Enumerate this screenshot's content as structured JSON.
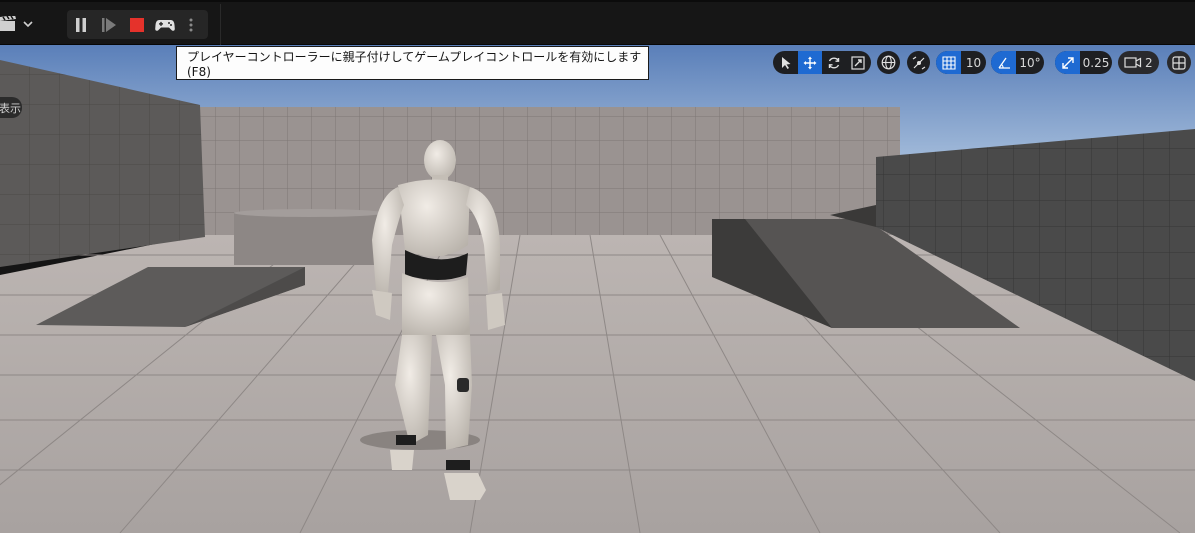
{
  "toolbar": {
    "mode_icon": "clapperboard-icon",
    "play_controls": [
      {
        "name": "pause-icon"
      },
      {
        "name": "step-frame-icon"
      },
      {
        "name": "stop-icon",
        "color": "#e5322b"
      },
      {
        "name": "gamepad-icon"
      },
      {
        "name": "more-options-icon"
      }
    ]
  },
  "tooltip": {
    "text": "プレイヤーコントローラーに親子付けしてゲームプレイコントロールを有効にします (F8)"
  },
  "viewport": {
    "display_label": "表示",
    "grid_snap_value": "10",
    "rotation_snap_value": "10°",
    "scale_snap_value": "0.25",
    "camera_speed_value": "2"
  },
  "colors": {
    "accent": "#1f6ad2",
    "toolbar_bg": "#161616",
    "sky": "#6d8fc3"
  }
}
